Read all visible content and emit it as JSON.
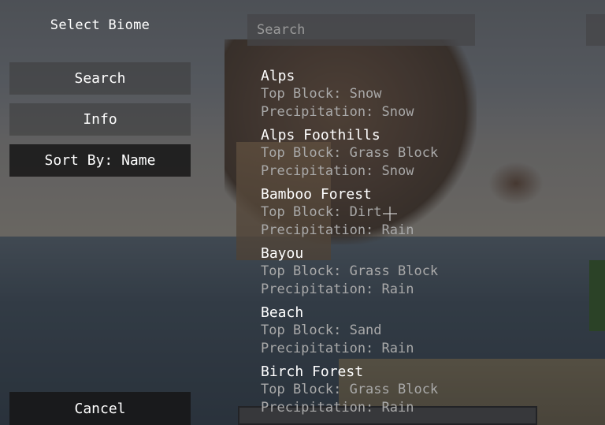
{
  "screen": {
    "title": "Select Biome"
  },
  "sidebar": {
    "search_label": "Search",
    "info_label": "Info",
    "sort_label": "Sort By: Name",
    "cancel_label": "Cancel"
  },
  "search": {
    "placeholder": "Search",
    "value": ""
  },
  "biomes": [
    {
      "name": "Alps",
      "top_block": "Top Block: Snow",
      "precipitation": "Precipitation: Snow"
    },
    {
      "name": "Alps Foothills",
      "top_block": "Top Block: Grass Block",
      "precipitation": "Precipitation: Snow"
    },
    {
      "name": "Bamboo Forest",
      "top_block": "Top Block: Dirt",
      "precipitation": "Precipitation: Rain"
    },
    {
      "name": "Bayou",
      "top_block": "Top Block: Grass Block",
      "precipitation": "Precipitation: Rain"
    },
    {
      "name": "Beach",
      "top_block": "Top Block: Sand",
      "precipitation": "Precipitation: Rain"
    },
    {
      "name": "Birch Forest",
      "top_block": "Top Block: Grass Block",
      "precipitation": "Precipitation: Rain"
    }
  ],
  "colors": {
    "name_text": "#ffffff",
    "detail_text": "#a9a9a9",
    "selected_button": "#161616"
  }
}
